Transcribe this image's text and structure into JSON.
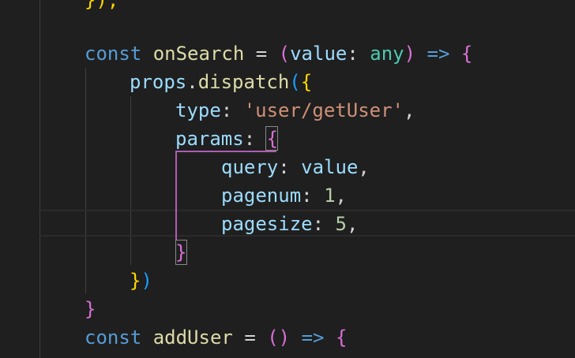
{
  "theme": {
    "background": "#1f1f1f",
    "keyword": "#569cd6",
    "function": "#dcdcaa",
    "variable": "#9cdcfe",
    "type": "#4ec9b0",
    "string": "#ce9178",
    "number": "#b5cea8",
    "bracket_level1": "#ffd700",
    "bracket_level2": "#da70d6",
    "bracket_level3": "#179fff",
    "scope_guide": "#b05cb5"
  },
  "code": {
    "line0": {
      "close": "});"
    },
    "line1": {
      "kw": "const",
      "name": "onSearch",
      "eq": "=",
      "open_paren": "(",
      "param": "value",
      "colon": ":",
      "type": "any",
      "close_paren": ")",
      "arrow": "=>",
      "brace": "{"
    },
    "line2": {
      "obj": "props",
      "dot": ".",
      "method": "dispatch",
      "paren": "(",
      "brace": "{"
    },
    "line3": {
      "key": "type",
      "colon": ":",
      "value": "'user/getUser'",
      "comma": ","
    },
    "line4": {
      "key": "params",
      "colon": ":",
      "brace": "{"
    },
    "line5": {
      "key": "query",
      "colon": ":",
      "value": "value",
      "comma": ","
    },
    "line6": {
      "key": "pagenum",
      "colon": ":",
      "value": "1",
      "comma": ","
    },
    "line7": {
      "key": "pagesize",
      "colon": ":",
      "value": "5",
      "comma": ","
    },
    "line8": {
      "brace": "}"
    },
    "line9": {
      "brace": "}",
      "paren": ")"
    },
    "line10": {
      "brace": "}"
    },
    "line11": {
      "kw": "const",
      "name": "addUser",
      "eq": "=",
      "parens": "()",
      "arrow": "=>",
      "brace": "{"
    }
  }
}
